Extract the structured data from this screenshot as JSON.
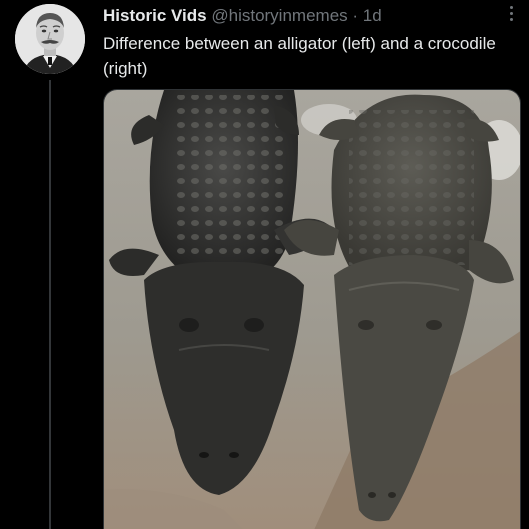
{
  "tweet": {
    "author_name": "Historic Vids",
    "author_handle": "@historyinmemes",
    "separator": "·",
    "timestamp": "1d",
    "text": "Difference between an alligator (left) and a crocodile (right)"
  },
  "icons": {
    "more": "more-options-icon",
    "avatar": "avatar-portrait"
  },
  "colors": {
    "background": "#000000",
    "primary_text": "#e7e9ea",
    "secondary_text": "#71767b",
    "divider": "#333639"
  }
}
